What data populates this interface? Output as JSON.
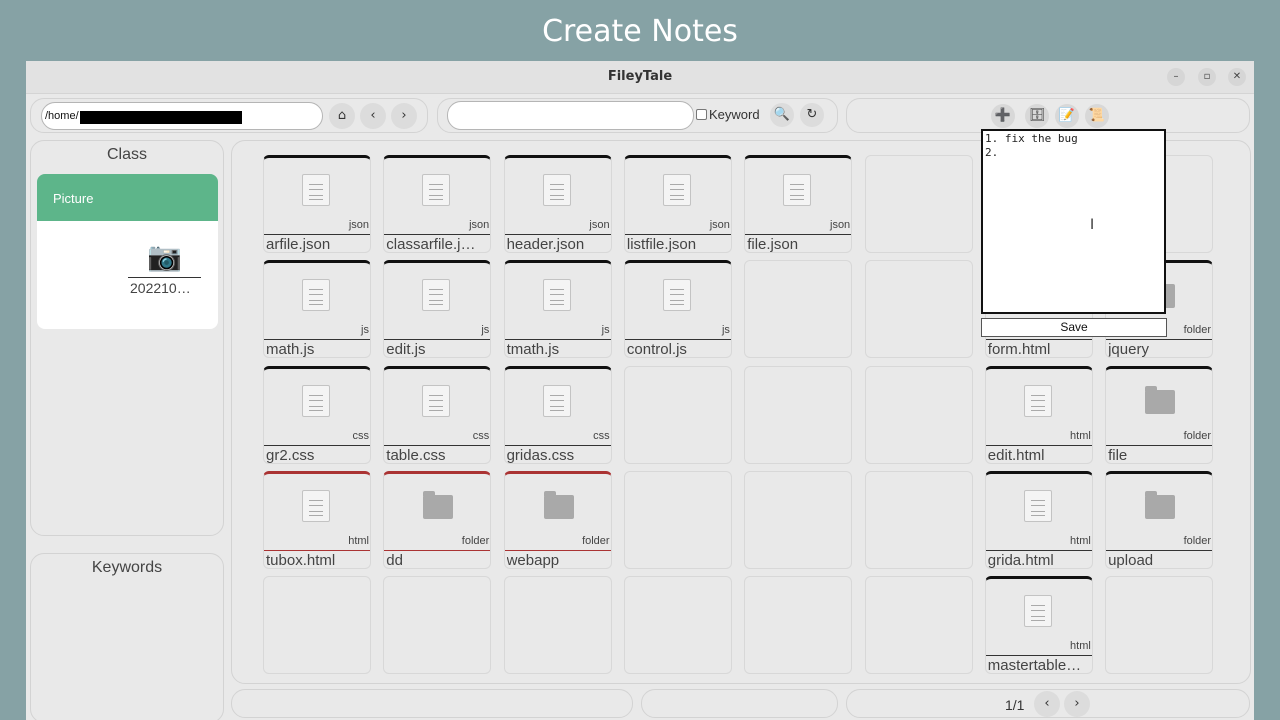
{
  "banner": "Create Notes",
  "window": {
    "title": "FileyTale"
  },
  "toolbar": {
    "path_prefix": "/home/",
    "home_icon": "home-icon",
    "back_icon": "chevron-left-icon",
    "forward_icon": "chevron-right-icon",
    "search_value": "",
    "keyword_label": "Keyword",
    "search_icon": "search-icon",
    "refresh_icon": "refresh-icon",
    "add_icon": "plus-icon",
    "db_icon": "database-icon",
    "note_icon": "note-icon",
    "scroll_icon": "scroll-icon"
  },
  "sidebar": {
    "class_heading": "Class",
    "class_selected": "Picture",
    "thumb_icon": "camera-icon",
    "thumb_name": "202210…",
    "keywords_heading": "Keywords"
  },
  "files": [
    {
      "name": "arfile.json",
      "ext": "json",
      "kind": "file",
      "mark": "dark"
    },
    {
      "name": "classarfile.j…",
      "ext": "json",
      "kind": "file",
      "mark": "dark"
    },
    {
      "name": "header.json",
      "ext": "json",
      "kind": "file",
      "mark": "dark"
    },
    {
      "name": "listfile.json",
      "ext": "json",
      "kind": "file",
      "mark": "dark"
    },
    {
      "name": "file.json",
      "ext": "json",
      "kind": "file",
      "mark": "dark"
    },
    {
      "name": "math.js",
      "ext": "js",
      "kind": "file",
      "mark": "dark"
    },
    {
      "name": "edit.js",
      "ext": "js",
      "kind": "file",
      "mark": "dark"
    },
    {
      "name": "tmath.js",
      "ext": "js",
      "kind": "file",
      "mark": "dark"
    },
    {
      "name": "control.js",
      "ext": "js",
      "kind": "file",
      "mark": "dark"
    },
    {
      "name": "form.html",
      "ext": "",
      "kind": "file",
      "mark": "dark"
    },
    {
      "name": "jquery",
      "ext": "folder",
      "kind": "folder",
      "mark": "dark"
    },
    {
      "name": "gr2.css",
      "ext": "css",
      "kind": "file",
      "mark": "dark"
    },
    {
      "name": "table.css",
      "ext": "css",
      "kind": "file",
      "mark": "dark"
    },
    {
      "name": "gridas.css",
      "ext": "css",
      "kind": "file",
      "mark": "dark"
    },
    {
      "name": "edit.html",
      "ext": "html",
      "kind": "file",
      "mark": "dark"
    },
    {
      "name": "file",
      "ext": "folder",
      "kind": "folder",
      "mark": "dark"
    },
    {
      "name": "tubox.html",
      "ext": "html",
      "kind": "file",
      "mark": "red"
    },
    {
      "name": "dd",
      "ext": "folder",
      "kind": "folder",
      "mark": "red"
    },
    {
      "name": "webapp",
      "ext": "folder",
      "kind": "folder",
      "mark": "red"
    },
    {
      "name": "grida.html",
      "ext": "html",
      "kind": "file",
      "mark": "dark"
    },
    {
      "name": "upload",
      "ext": "folder",
      "kind": "folder",
      "mark": "dark"
    },
    {
      "name": "mastertable…",
      "ext": "html",
      "kind": "file",
      "mark": "dark"
    }
  ],
  "notes": {
    "text": "1. fix the bug\n2.",
    "save_label": "Save"
  },
  "pager": {
    "text": "1/1",
    "prev_icon": "chevron-left-icon",
    "next_icon": "chevron-right-icon"
  }
}
